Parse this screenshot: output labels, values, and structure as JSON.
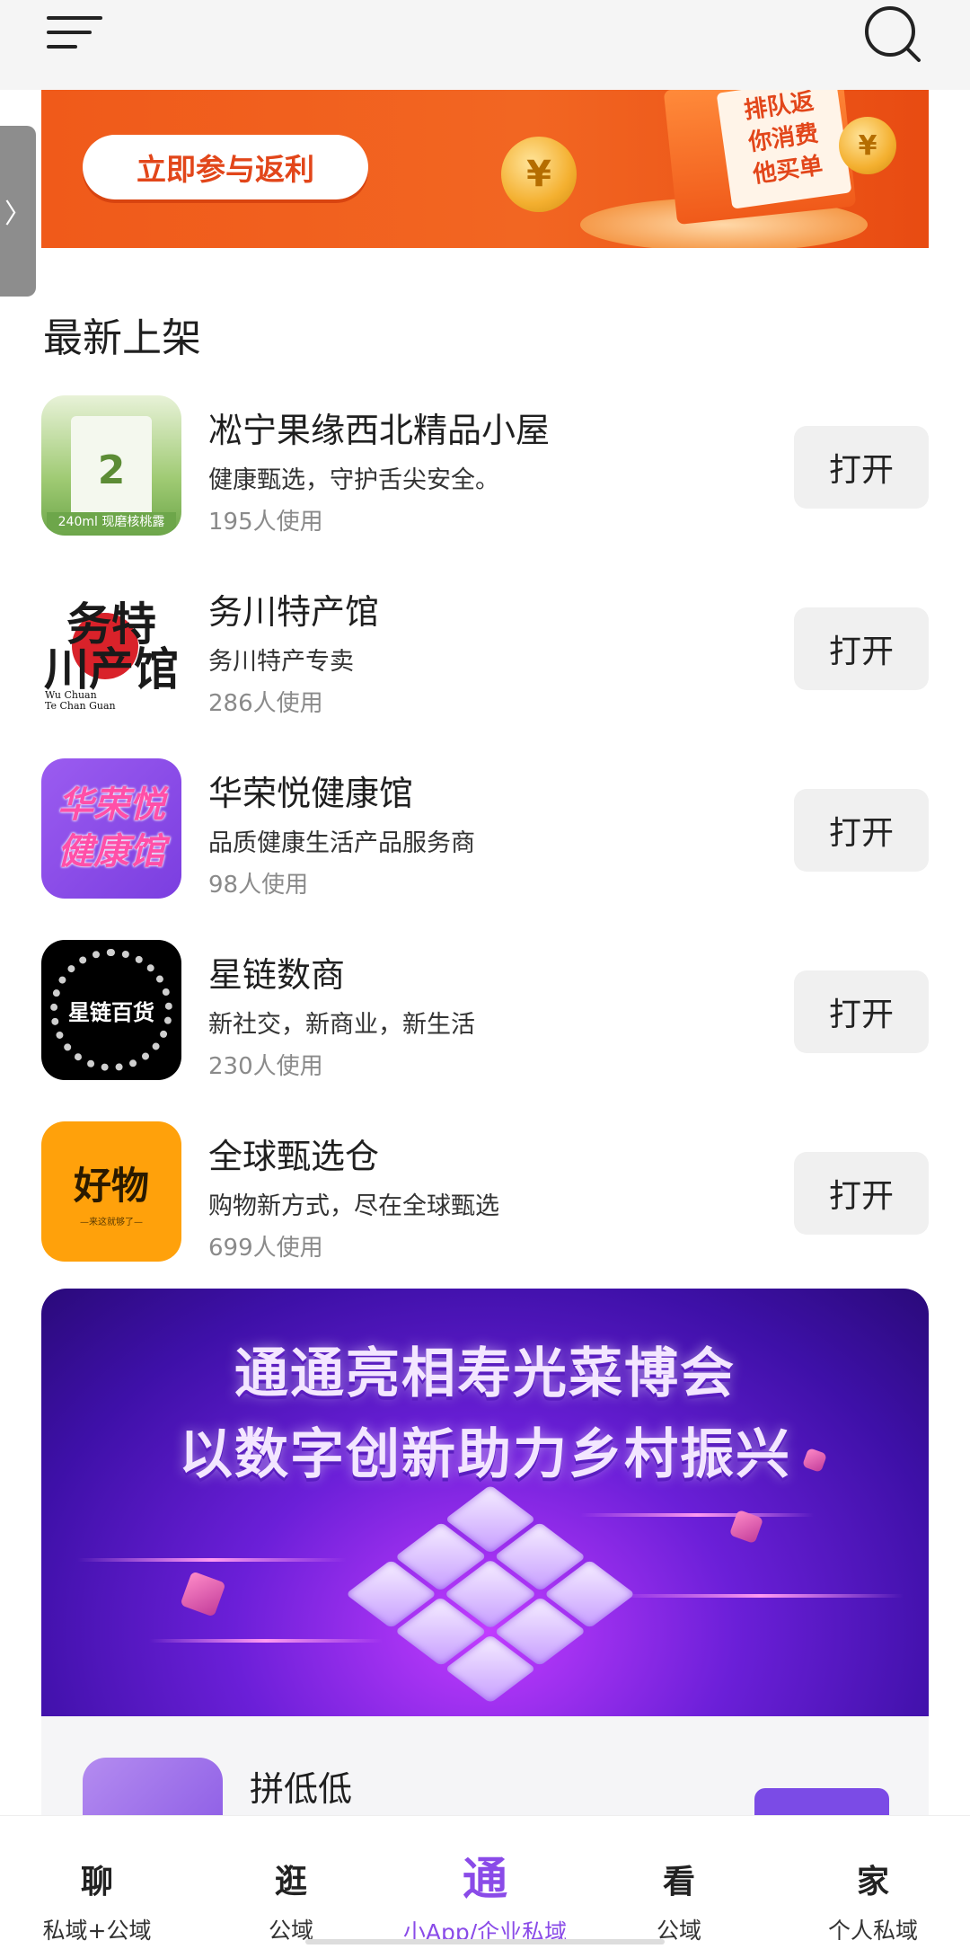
{
  "topbar": {
    "menu_icon": "hamburger-menu-icon",
    "search_icon": "search-icon"
  },
  "banner_top": {
    "cta_label": "立即参与返利",
    "sign_text": [
      "排队返",
      "你消费",
      "他买单"
    ],
    "coin_symbol": "¥",
    "colors": {
      "primary": "#f05a1a",
      "button_text": "#e2461a"
    }
  },
  "side_handle": {
    "glyph": "〉"
  },
  "section": {
    "title": "最新上架"
  },
  "apps": [
    {
      "name": "凇宁果缘西北精品小屋",
      "desc": "健康甄选，守护舌尖安全。",
      "usage": "195人使用",
      "button": "打开",
      "icon": "walnut-milk-icon",
      "icon_text": {
        "big": "2",
        "volume": "240ml",
        "tag": "现磨核桃露"
      }
    },
    {
      "name": "务川特产馆",
      "desc": "务川特产专卖",
      "usage": "286人使用",
      "button": "打开",
      "icon": "wuchuan-calligraphy-logo-icon",
      "icon_text": {
        "main": "务特\n川产馆",
        "sub": "Wu Chuan\nTe Chan Guan"
      }
    },
    {
      "name": "华荣悦健康馆",
      "desc": "品质健康生活产品服务商",
      "usage": "98人使用",
      "button": "打开",
      "icon": "huarongyue-logo-icon",
      "icon_text": {
        "line1": "华荣悦",
        "line2": "健康馆"
      }
    },
    {
      "name": "星链数商",
      "desc": "新社交，新商业，新生活",
      "usage": "230人使用",
      "button": "打开",
      "icon": "star-chain-logo-icon",
      "icon_text": {
        "main": "星链百货"
      }
    },
    {
      "name": "全球甄选仓",
      "desc": "购物新方式，尽在全球甄选",
      "usage": "699人使用",
      "button": "打开",
      "icon": "haowu-logo-icon",
      "icon_text": {
        "main": "好物",
        "sub": "—来这就够了—"
      }
    }
  ],
  "banner_purple": {
    "line1": "通通亮相寿光菜博会",
    "line2": "以数字创新助力乡村振兴",
    "colors": {
      "bg": "#6b1fd8",
      "accent": "#c23cff"
    }
  },
  "partial_card": {
    "name": "拼低低",
    "icon": "pindidi-logo-icon"
  },
  "bottom_nav": [
    {
      "glyph": "聊",
      "label": "私域+公域",
      "active": false
    },
    {
      "glyph": "逛",
      "label": "公域",
      "active": false
    },
    {
      "glyph": "通",
      "label": "小App/企业私域",
      "active": true
    },
    {
      "glyph": "看",
      "label": "公域",
      "active": false
    },
    {
      "glyph": "家",
      "label": "个人私域",
      "active": false
    }
  ],
  "theme": {
    "active_color": "#8a4be8",
    "button_bg": "#f0f0f0"
  }
}
